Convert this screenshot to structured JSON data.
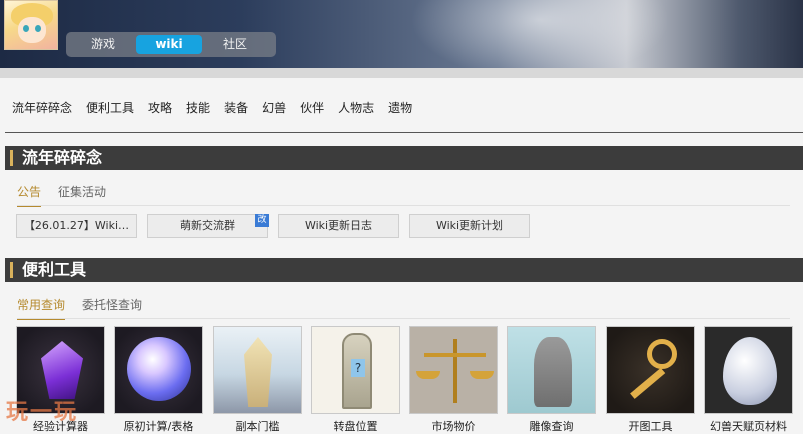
{
  "header": {
    "nav_tabs": [
      {
        "label": "游戏"
      },
      {
        "label": "wiki"
      },
      {
        "label": "社区"
      }
    ]
  },
  "category_nav": {
    "items": [
      "流年碎碎念",
      "便利工具",
      "攻略",
      "技能",
      "装备",
      "幻兽",
      "伙伴",
      "人物志",
      "遗物"
    ]
  },
  "sections": {
    "news": {
      "title": "流年碎碎念",
      "tabs": [
        "公告",
        "征集活动"
      ],
      "links": [
        "【26.01.27】Wiki…",
        "萌新交流群",
        "Wiki更新日志",
        "Wiki更新计划"
      ],
      "edit_badge": "改"
    },
    "tools": {
      "title": "便利工具",
      "tabs": [
        "常用查询",
        "委托怪查询"
      ],
      "cards": [
        "经验计算器",
        "原初计算/表格",
        "副本门槛",
        "转盘位置",
        "市场物价",
        "雕像查询",
        "开图工具",
        "幻兽天赋页材料"
      ]
    }
  },
  "watermark": "玩一玩",
  "colors": {
    "active_tab": "#17a3e0",
    "accent_gold": "#b58a2e",
    "section_bar": "#3c3c3c"
  }
}
